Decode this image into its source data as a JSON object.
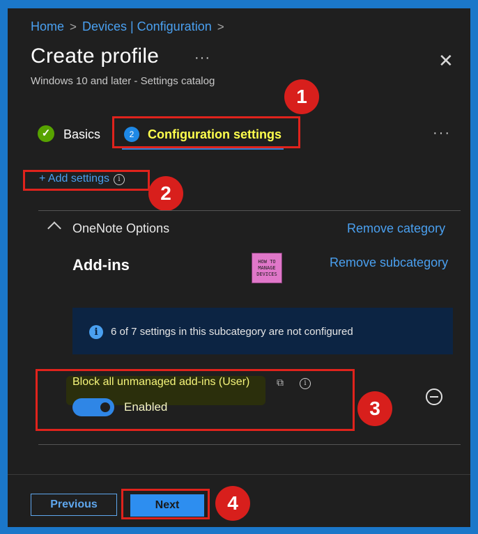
{
  "breadcrumb": {
    "home": "Home",
    "devices": "Devices | Configuration",
    "separator": ">"
  },
  "header": {
    "title": "Create profile",
    "more": "···",
    "subtitle": "Windows 10 and later - Settings catalog",
    "close": "✕"
  },
  "tabs": {
    "basics_label": "Basics",
    "config_number": "2",
    "config_label": "Configuration settings",
    "more": "···"
  },
  "add_settings": {
    "label": "+ Add settings"
  },
  "category": {
    "name": "OneNote Options",
    "remove_label": "Remove category",
    "subcategory": "Add-ins",
    "remove_subcategory_label": "Remove subcategory"
  },
  "logo": {
    "line1": "HOW TO",
    "line2": "MANAGE",
    "line3": "DEVICES"
  },
  "info_bar": {
    "text": "6 of 7 settings in this subcategory are not configured"
  },
  "setting": {
    "name": "Block all unmanaged add-ins (User)",
    "value": "Enabled",
    "enabled": true
  },
  "footer": {
    "previous_label": "Previous",
    "next_label": "Next"
  },
  "callouts": [
    "1",
    "2",
    "3",
    "4"
  ],
  "colors": {
    "accent": "#4aa0f0",
    "annotation_red": "#e0231c",
    "highlight_text": "#ffff4d",
    "frame_border": "#1b77c9"
  }
}
